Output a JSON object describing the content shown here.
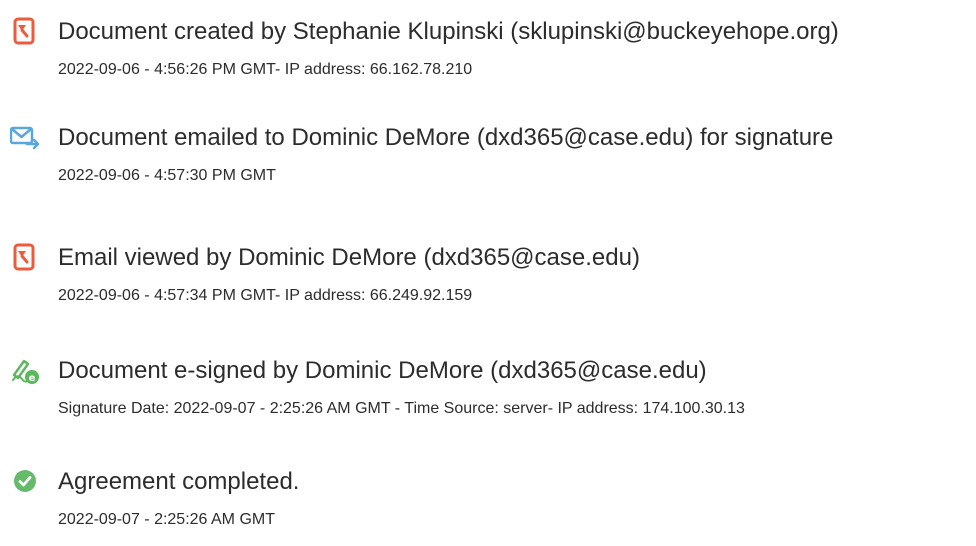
{
  "events": [
    {
      "icon": "document-created-icon",
      "title": "Document created by Stephanie Klupinski (sklupinski@buckeyehope.org)",
      "detail": "2022-09-06 - 4:56:26 PM GMT- IP address: 66.162.78.210"
    },
    {
      "icon": "email-sent-icon",
      "title": "Document emailed to Dominic DeMore (dxd365@case.edu) for signature",
      "detail": "2022-09-06 - 4:57:30 PM GMT"
    },
    {
      "icon": "document-viewed-icon",
      "title": "Email viewed by Dominic DeMore (dxd365@case.edu)",
      "detail": "2022-09-06 - 4:57:34 PM GMT- IP address: 66.249.92.159"
    },
    {
      "icon": "e-sign-icon",
      "title": "Document e-signed by Dominic DeMore (dxd365@case.edu)",
      "detail": "Signature Date: 2022-09-07 - 2:25:26 AM GMT - Time Source: server- IP address: 174.100.30.13"
    },
    {
      "icon": "checkmark-circle-icon",
      "title": "Agreement completed.",
      "detail": "2022-09-07 - 2:25:26 AM GMT"
    }
  ],
  "colors": {
    "acrobat_red": "#ee5a3c",
    "email_blue": "#5ba7dd",
    "sign_green": "#5cb85c",
    "check_green": "#66bb6a"
  }
}
